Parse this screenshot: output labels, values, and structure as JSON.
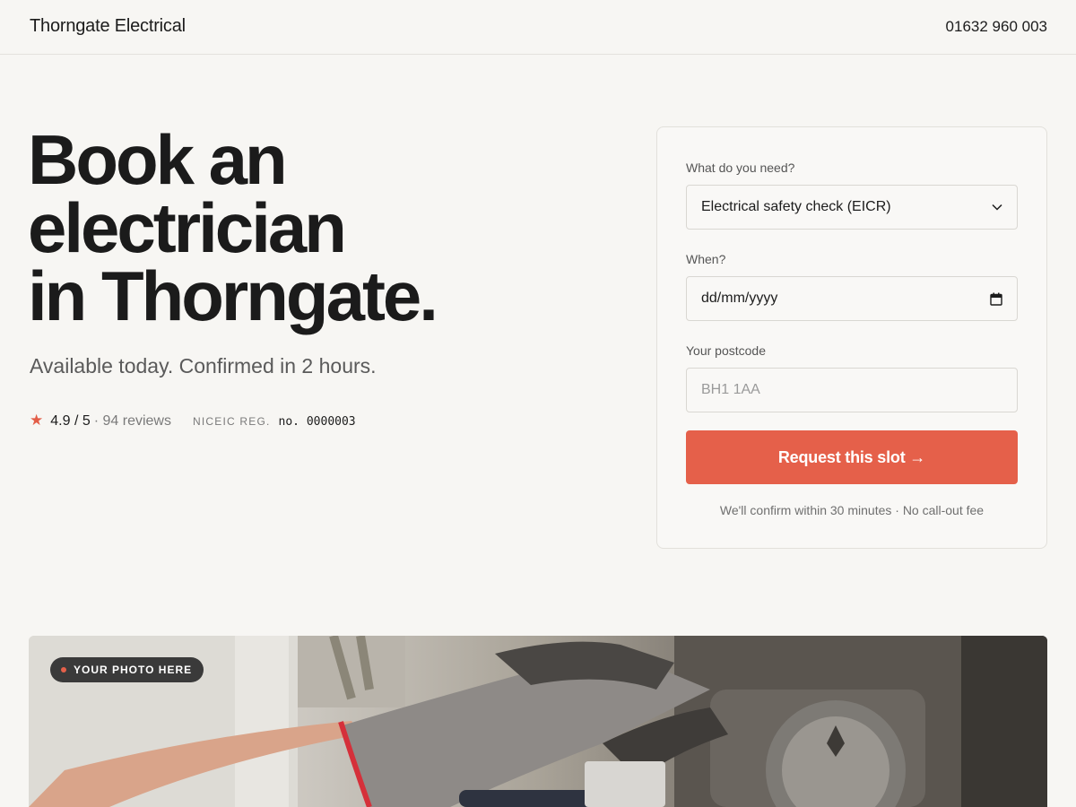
{
  "header": {
    "brand": "Thorngate Electrical",
    "phone": "01632 960 003"
  },
  "hero": {
    "title_lines": [
      "Book an",
      "electrician",
      "in Thorngate."
    ],
    "subtitle": "Available today. Confirmed in 2 hours.",
    "rating": "4.9 / 5",
    "reviews": "· 94 reviews",
    "reg_label": "NICEIC REG.",
    "reg_number": "no. 0000003"
  },
  "booking": {
    "service_label": "What do you need?",
    "service_value": "Electrical safety check (EICR)",
    "when_label": "When?",
    "when_value": "dd/mm/yyyy",
    "postcode_label": "Your postcode",
    "postcode_placeholder": "BH1 1AA",
    "submit_label": "Request this slot →",
    "note": "We'll confirm within 30 minutes · No call-out fee"
  },
  "photo": {
    "badge": "YOUR PHOTO HERE"
  },
  "colors": {
    "accent": "#e5604a",
    "background": "#f7f6f3",
    "text": "#1c1c1c"
  },
  "icons": {
    "star": "star-icon",
    "select": "chevron-down-icon",
    "date": "calendar-icon"
  }
}
